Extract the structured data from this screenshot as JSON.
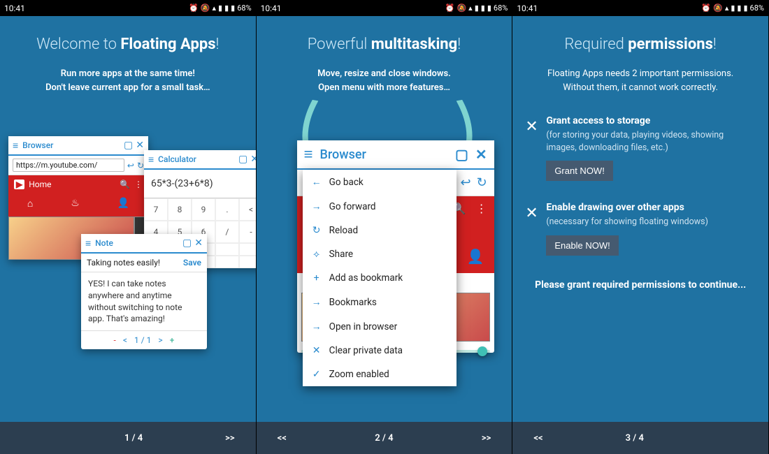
{
  "status": {
    "time": "10:41",
    "battery": "68%"
  },
  "p1": {
    "title_pre": "Welcome to ",
    "title_bold": "Floating Apps",
    "title_post": "!",
    "sub1": "Run more apps at the same time!",
    "sub2": "Don't leave current app for a small task…",
    "browser": {
      "title": "Browser",
      "url": "https://m.youtube.com/",
      "home": "Home"
    },
    "calc": {
      "title": "Calculator",
      "expr": "65*3-(23+6*8)",
      "keys": [
        [
          "7",
          "8",
          "9",
          ".",
          "<"
        ],
        [
          "4",
          "5",
          "6",
          "/",
          "-"
        ],
        [
          "",
          "",
          "",
          "",
          ""
        ],
        [
          "",
          "",
          "",
          "",
          ""
        ]
      ]
    },
    "note": {
      "title": "Note",
      "header_text": "Taking notes easily!",
      "save": "Save",
      "body": "YES! I can take notes anywhere and anytime without switching to note app. That's amazing!",
      "page": "1 / 1"
    },
    "footer_page": "1 / 4",
    "footer_next": ">>"
  },
  "p2": {
    "title_pre": "Powerful ",
    "title_bold": "multitasking",
    "title_post": "!",
    "sub1": "Move, resize and close windows.",
    "sub2": "Open menu with more features…",
    "browser_title": "Browser",
    "menu": [
      "Go back",
      "Go forward",
      "Reload",
      "Share",
      "Add as bookmark",
      "Bookmarks",
      "Open in browser",
      "Clear private data",
      "Zoom enabled"
    ],
    "menu_icons": [
      "←",
      "→",
      "↻",
      "⟡",
      "+",
      "→",
      "→",
      "✕",
      "✓"
    ],
    "footer_prev": "<<",
    "footer_page": "2 / 4",
    "footer_next": ">>"
  },
  "p3": {
    "title_pre": "Required ",
    "title_bold": "permissions",
    "title_post": "!",
    "sub1": "Floating Apps needs 2 important permissions.",
    "sub2": "Without them, it cannot work correctly.",
    "perm1": {
      "title": "Grant access to storage",
      "desc": "(for storing your data, playing videos, showing images, downloading files, etc.)",
      "btn": "Grant NOW!"
    },
    "perm2": {
      "title": "Enable drawing over other apps",
      "desc": "(necessary for showing floating windows)",
      "btn": "Enable NOW!"
    },
    "continue_msg": "Please grant required permissions to continue...",
    "footer_prev": "<<",
    "footer_page": "3 / 4"
  }
}
